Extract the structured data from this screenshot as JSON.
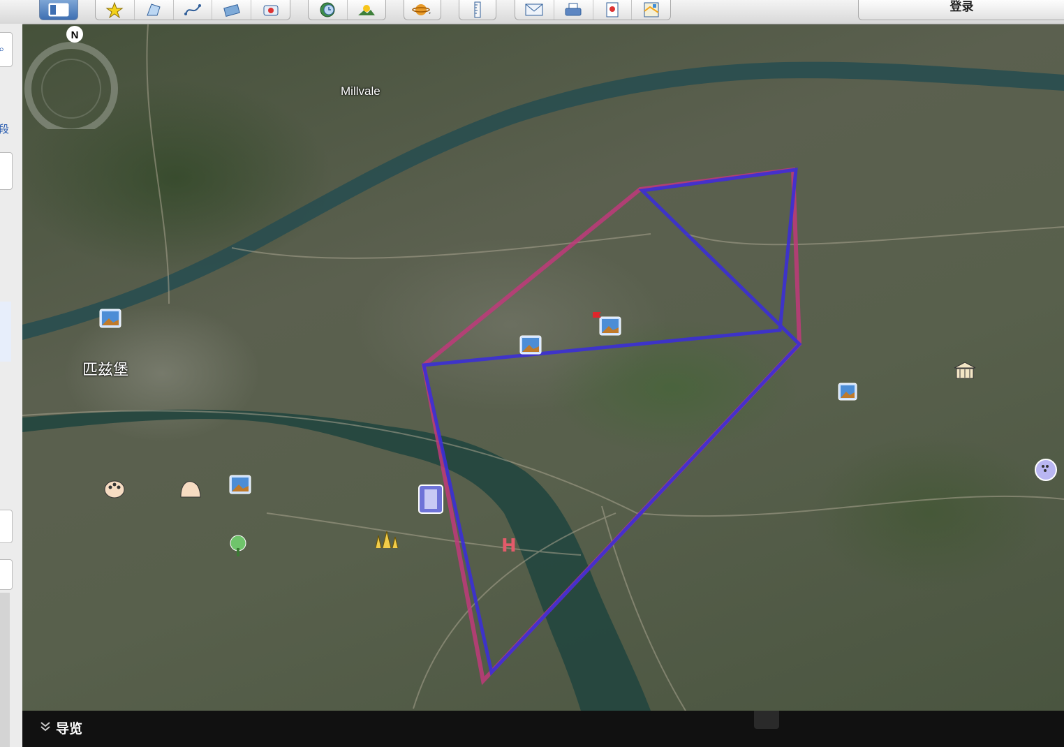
{
  "toolbar": {
    "signin_label": "登录",
    "buttons": [
      {
        "icon": "sidebar-toggle-icon"
      },
      {
        "icon": "placemark-icon"
      },
      {
        "icon": "polygon-icon"
      },
      {
        "icon": "path-icon"
      },
      {
        "icon": "image-overlay-icon"
      },
      {
        "icon": "record-tour-icon"
      },
      {
        "icon": "historical-imagery-icon"
      },
      {
        "icon": "sunlight-icon"
      },
      {
        "icon": "planets-icon"
      },
      {
        "icon": "ruler-icon"
      },
      {
        "icon": "email-icon"
      },
      {
        "icon": "print-icon"
      },
      {
        "icon": "save-image-icon"
      },
      {
        "icon": "view-in-maps-icon"
      }
    ]
  },
  "sidebar": {
    "fragments": [
      "段"
    ]
  },
  "map": {
    "labels": {
      "millvale": "Millvale",
      "pittsburgh": "匹兹堡"
    },
    "compass_label": "N",
    "overlay_colors": {
      "outline_a": "#c0397a",
      "outline_b": "#3b2fd6"
    }
  },
  "nav": {
    "label": "导览"
  }
}
